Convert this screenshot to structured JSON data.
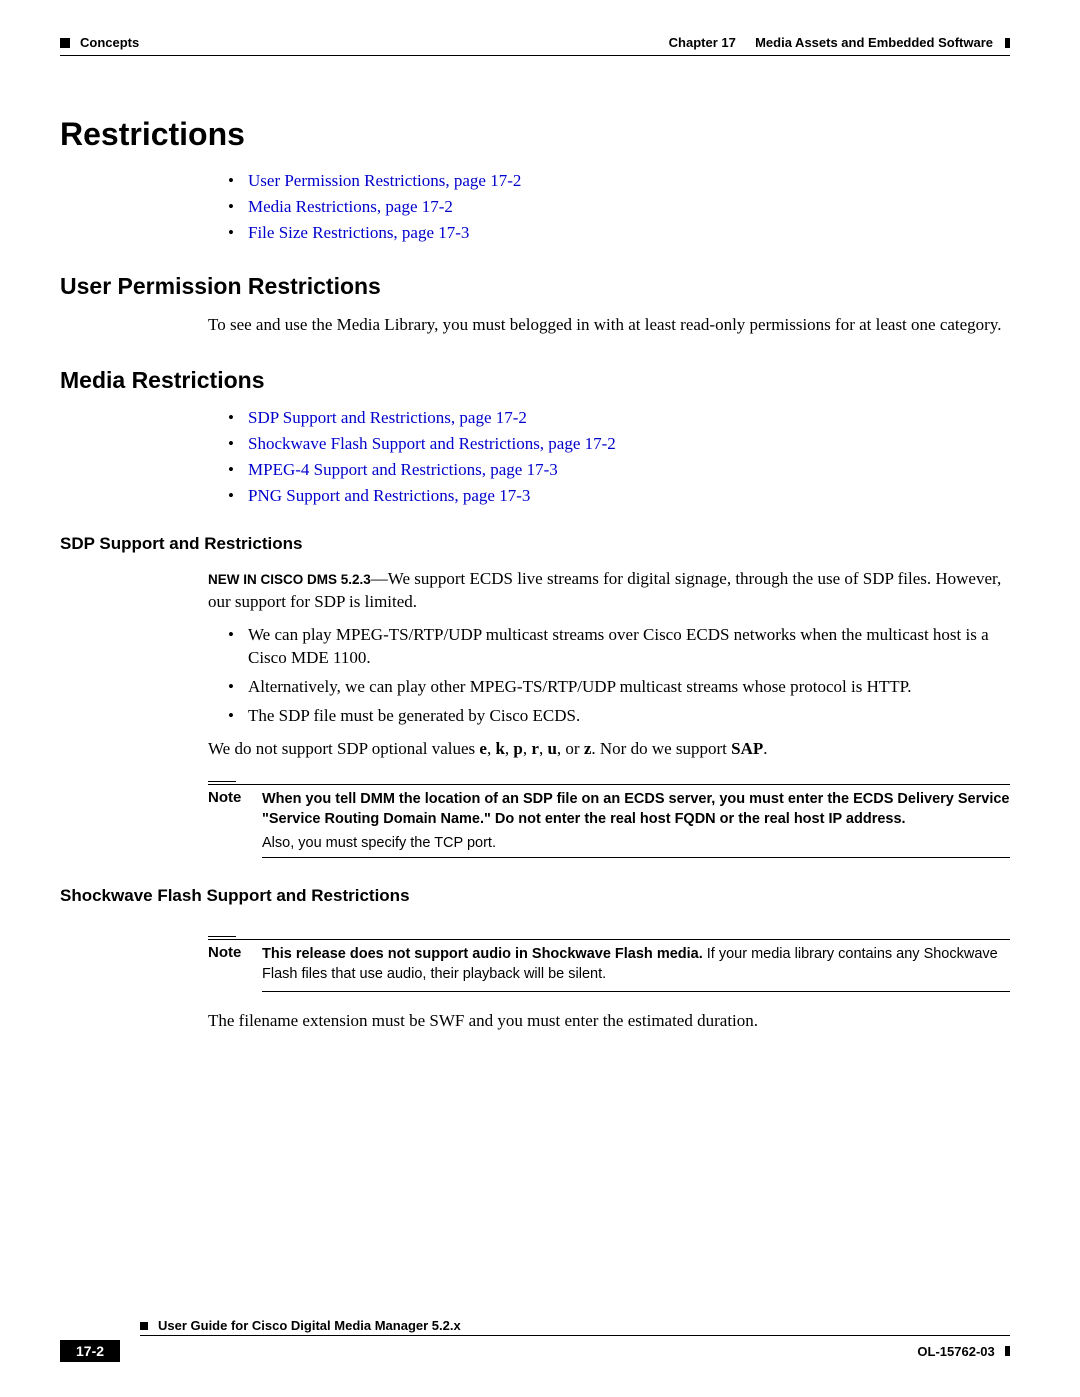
{
  "header": {
    "left_label": "Concepts",
    "chapter_label": "Chapter 17",
    "chapter_title": "Media Assets and Embedded Software"
  },
  "h1": "Restrictions",
  "toc1": {
    "item1": "User Permission Restrictions, page 17-2",
    "item2": "Media Restrictions, page 17-2",
    "item3": "File Size Restrictions, page 17-3"
  },
  "section_user_perm": {
    "title": "User Permission Restrictions",
    "body": "To see and use the Media Library, you must belogged in with at least read-only permissions for at least one category."
  },
  "section_media": {
    "title": "Media Restrictions",
    "links": {
      "l1": "SDP Support and Restrictions, page 17-2",
      "l2": "Shockwave Flash Support and Restrictions, page 17-2",
      "l3": "MPEG-4 Support and Restrictions, page 17-3",
      "l4": "PNG Support and Restrictions, page 17-3"
    }
  },
  "sdp": {
    "title": "SDP Support and Restrictions",
    "new_tag": "NEW IN CISCO DMS 5.2.3",
    "intro": "—We support ECDS live streams for digital signage, through the use of SDP files. However, our support for SDP is limited.",
    "b1": "We can play MPEG-TS/RTP/UDP multicast streams over Cisco ECDS networks when the multicast host is a Cisco MDE 1100.",
    "b2": "Alternatively, we can play other MPEG-TS/RTP/UDP multicast streams whose protocol is HTTP.",
    "b3": "The SDP file must be generated by Cisco ECDS.",
    "after_pre": "We do not support SDP optional values ",
    "vals": {
      "e": "e",
      "k": "k",
      "p": "p",
      "r": "r",
      "u": "u",
      "z": "z"
    },
    "after_mid": ". Nor do we support ",
    "sap": "SAP",
    "after_end": ".",
    "note_label": "Note",
    "note_text": "When you tell DMM the location of an SDP file on an ECDS server, you must enter the ECDS Delivery Service \"Service Routing Domain Name.\" Do not enter the real host FQDN or the real host IP address.",
    "note_sub": "Also, you must specify the TCP port."
  },
  "swf": {
    "title": "Shockwave Flash Support and Restrictions",
    "note_label": "Note",
    "note_bold": "This release does not support audio in Shockwave Flash media.",
    "note_rest": " If your media library contains any Shockwave Flash files that use audio, their playback will be silent.",
    "body": "The filename extension must be SWF and you must enter the estimated duration."
  },
  "footer": {
    "title": "User Guide for Cisco Digital Media Manager 5.2.x",
    "page": "17-2",
    "doc_id": "OL-15762-03"
  }
}
